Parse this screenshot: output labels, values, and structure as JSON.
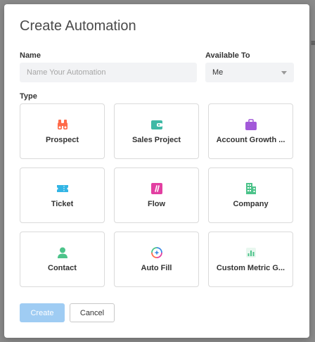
{
  "modal": {
    "title": "Create Automation"
  },
  "form": {
    "name_label": "Name",
    "name_placeholder": "Name Your Automation",
    "name_value": "",
    "available_label": "Available To",
    "available_value": "Me",
    "type_label": "Type"
  },
  "types": [
    {
      "label": "Prospect",
      "icon": "binoculars-icon",
      "color": "#ff6b4a"
    },
    {
      "label": "Sales Project",
      "icon": "wallet-icon",
      "color": "#3fb9a6"
    },
    {
      "label": "Account Growth ...",
      "icon": "briefcase-icon",
      "color": "#a259d9"
    },
    {
      "label": "Ticket",
      "icon": "ticket-icon",
      "color": "#33b5e5"
    },
    {
      "label": "Flow",
      "icon": "flow-icon",
      "color": "#e23fa1"
    },
    {
      "label": "Company",
      "icon": "building-icon",
      "color": "#4cc38a"
    },
    {
      "label": "Contact",
      "icon": "person-icon",
      "color": "#4cc38a"
    },
    {
      "label": "Auto Fill",
      "icon": "autofill-icon",
      "color": "#3f8ce5"
    },
    {
      "label": "Custom Metric G...",
      "icon": "bar-chart-icon",
      "color": "#4cc38a"
    }
  ],
  "actions": {
    "create_label": "Create",
    "cancel_label": "Cancel"
  }
}
